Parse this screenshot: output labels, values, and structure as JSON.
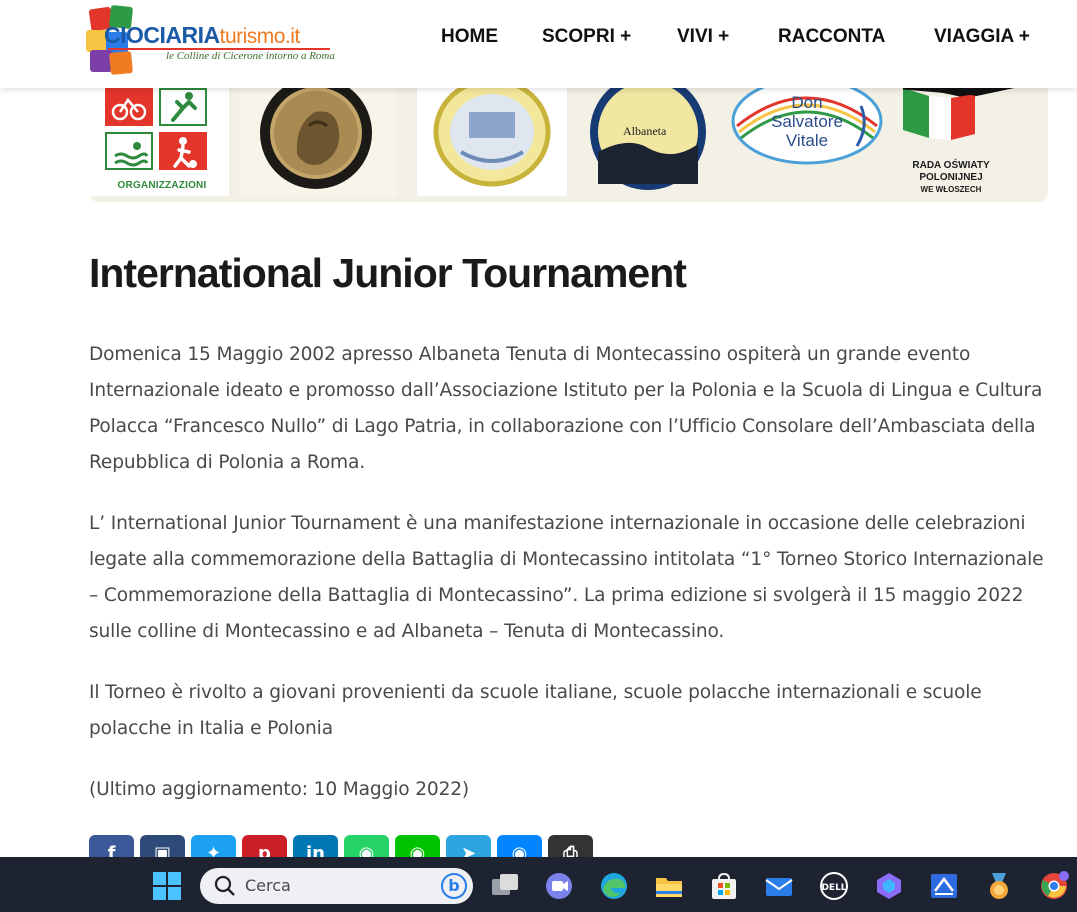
{
  "header": {
    "logo": {
      "name_part1": "CIOCIARIA",
      "name_part2": "turismo.it",
      "tagline": "le Colline di Cicerone intorno a Roma"
    },
    "nav": [
      {
        "label": "HOME"
      },
      {
        "label": "SCOPRI +"
      },
      {
        "label": "VIVI +"
      },
      {
        "label": "RACCONTA"
      },
      {
        "label": "VIAGGIA +"
      }
    ]
  },
  "banner": {
    "organizzazioni_label": "ORGANIZZAZIONI",
    "don_salvatore": [
      "Don",
      "Salvatore",
      "Vitale"
    ],
    "albaneta_text": "Albaneta",
    "rada": [
      "RADA OŚWIATY",
      "POLONIJNEJ",
      "WE WŁOSZECH"
    ]
  },
  "article": {
    "title": "International Junior Tournament",
    "paragraphs": [
      "Domenica 15 Maggio 2002 apresso Albaneta Tenuta di Montecassino ospiterà un grande evento Internazionale ideato e promosso dall’Associazione Istituto per la Polonia e la Scuola di Lingua e Cultura Polacca “Francesco Nullo” di Lago Patria, in collaborazione con l’Ufficio Consolare dell’Ambasciata della Repubblica di Polonia a Roma.",
      "L’ International Junior Tournament è una manifestazione internazionale in occasione delle celebrazioni legate alla commemorazione della Battaglia di Montecassino intitolata “1° Torneo Storico Internazionale – Commemorazione della Battaglia di Montecassino”. La prima edizione si svolgerà il 15 maggio 2022 sulle colline di Montecassino e ad Albaneta – Tenuta di Montecassino.",
      "Il Torneo è rivolto a giovani provenienti da scuole italiane, scuole polacche internazionali e scuole polacche in Italia e Polonia",
      "(Ultimo aggiornamento: 10 Maggio 2022)"
    ]
  },
  "share_buttons": [
    {
      "icon": "facebook-icon",
      "glyph": "f",
      "color": "#3b5998"
    },
    {
      "icon": "flipboard-icon",
      "glyph": "▣",
      "color": "#2d4a78"
    },
    {
      "icon": "twitter-icon",
      "glyph": "✦",
      "color": "#1da1f2"
    },
    {
      "icon": "pinterest-icon",
      "glyph": "p",
      "color": "#cb2027"
    },
    {
      "icon": "linkedin-icon",
      "glyph": "in",
      "color": "#0077b5"
    },
    {
      "icon": "whatsapp-icon",
      "glyph": "◉",
      "color": "#25d366"
    },
    {
      "icon": "line-icon",
      "glyph": "◉",
      "color": "#00c300"
    },
    {
      "icon": "telegram-icon",
      "glyph": "➤",
      "color": "#2ca5e0"
    },
    {
      "icon": "messenger-icon",
      "glyph": "◉",
      "color": "#0084ff"
    },
    {
      "icon": "print-icon",
      "glyph": "⎙",
      "color": "#333333"
    }
  ],
  "taskbar": {
    "search_placeholder": "Cerca",
    "bing_glyph": "b",
    "icons": [
      {
        "name": "windows-start-icon",
        "color": "#4cc2ff"
      },
      {
        "name": "task-view-icon",
        "color": "#dcdcdc"
      },
      {
        "name": "teams-meet-icon",
        "color": "#7b83eb"
      },
      {
        "name": "edge-icon",
        "color": "#1fa8e0"
      },
      {
        "name": "file-explorer-icon",
        "color": "#f6c343"
      },
      {
        "name": "microsoft-store-icon",
        "color": "#ffffff"
      },
      {
        "name": "mail-icon",
        "color": "#2b7de9"
      },
      {
        "name": "dell-icon",
        "color": "#ffffff"
      },
      {
        "name": "copilot-icon",
        "color": "#8a6cf7"
      },
      {
        "name": "document-app-icon",
        "color": "#2f6be0"
      },
      {
        "name": "badge-app-icon",
        "color": "#f3a73a"
      },
      {
        "name": "chrome-icon",
        "color": "#e6463a"
      }
    ]
  },
  "colors": {
    "title": "#1a1a1a",
    "body_text": "#4a4a4a",
    "taskbar_bg": "#1d2330",
    "logo_blue": "#1b5aa6",
    "logo_orange": "#f07b22"
  }
}
